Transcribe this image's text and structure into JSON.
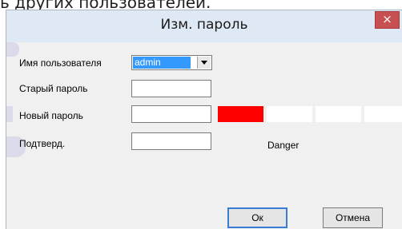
{
  "background_text": "ь других пользователей.",
  "dialog": {
    "title": "Изм. пароль",
    "close_symbol": "×"
  },
  "form": {
    "username_label": "Имя пользователя",
    "username_value": "admin",
    "old_password_label": "Старый пароль",
    "new_password_label": "Новый пароль",
    "confirm_label": "Подтверд.",
    "old_password_value": "",
    "new_password_value": "",
    "confirm_value": ""
  },
  "strength": {
    "label": "Danger",
    "level": 1,
    "segments": 5,
    "active_color": "#ff0000",
    "inactive_color": "#ffffff"
  },
  "buttons": {
    "ok_label": "Ок",
    "cancel_label": "Отмена"
  }
}
